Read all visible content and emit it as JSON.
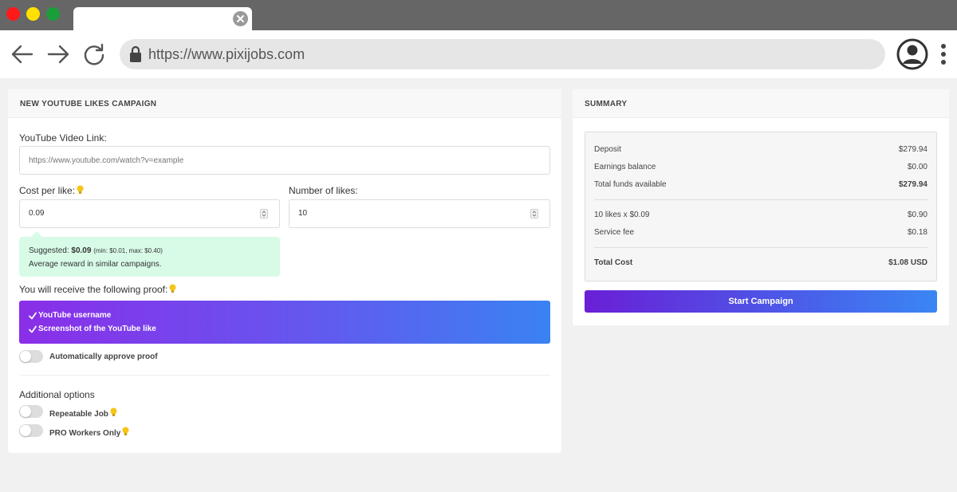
{
  "browser": {
    "url": "https://www.pixijobs.com",
    "icons": [
      "back-icon",
      "forward-icon",
      "reload-icon",
      "lock-icon",
      "profile-icon",
      "kebab-menu-icon",
      "tab-close-icon"
    ]
  },
  "campaign": {
    "header": "NEW YOUTUBE LIKES CAMPAIGN",
    "video_link_label": "YouTube Video Link:",
    "video_link_placeholder": "https://www.youtube.com/watch?v=example",
    "cost_label": "Cost per like:",
    "cost_value": "0.09",
    "likes_label": "Number of likes:",
    "likes_value": "10",
    "suggest_prefix": "Suggested:",
    "suggest_value": "$0.09",
    "suggest_range": "(min: $0.01, max: $0.40)",
    "suggest_note": "Average reward in similar campaigns.",
    "proof_label": "You will receive the following proof:",
    "proof_items": [
      "YouTube username",
      "Screenshot of the YouTube like"
    ],
    "auto_approve_label": "Automatically approve proof",
    "additional_label": "Additional options",
    "repeatable_label": "Repeatable Job",
    "pro_workers_label": "PRO Workers Only"
  },
  "summary": {
    "header": "SUMMARY",
    "rows": [
      {
        "label": "Deposit",
        "value": "$279.94"
      },
      {
        "label": "Earnings balance",
        "value": "$0.00"
      },
      {
        "label": "Total funds available",
        "value": "$279.94"
      },
      {
        "label": "10 likes x $0.09",
        "value": "$0.90"
      },
      {
        "label": "Service fee",
        "value": "$0.18"
      },
      {
        "label": "Total Cost",
        "value": "$1.08 USD"
      }
    ],
    "start_button": "Start Campaign"
  },
  "colors": {
    "titlebar": "#666666",
    "suggest_bg": "#d8fbe8",
    "gradient_start": "#8a2ee8",
    "gradient_end": "#3a82f2",
    "bulb": "#f5c518"
  }
}
